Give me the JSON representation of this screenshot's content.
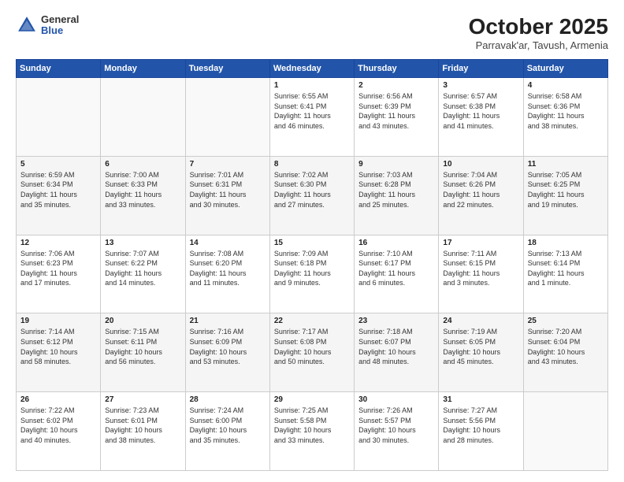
{
  "header": {
    "logo_general": "General",
    "logo_blue": "Blue",
    "title": "October 2025",
    "subtitle": "Parravak'ar, Tavush, Armenia"
  },
  "weekdays": [
    "Sunday",
    "Monday",
    "Tuesday",
    "Wednesday",
    "Thursday",
    "Friday",
    "Saturday"
  ],
  "rows": [
    [
      {
        "day": "",
        "info": ""
      },
      {
        "day": "",
        "info": ""
      },
      {
        "day": "",
        "info": ""
      },
      {
        "day": "1",
        "info": "Sunrise: 6:55 AM\nSunset: 6:41 PM\nDaylight: 11 hours\nand 46 minutes."
      },
      {
        "day": "2",
        "info": "Sunrise: 6:56 AM\nSunset: 6:39 PM\nDaylight: 11 hours\nand 43 minutes."
      },
      {
        "day": "3",
        "info": "Sunrise: 6:57 AM\nSunset: 6:38 PM\nDaylight: 11 hours\nand 41 minutes."
      },
      {
        "day": "4",
        "info": "Sunrise: 6:58 AM\nSunset: 6:36 PM\nDaylight: 11 hours\nand 38 minutes."
      }
    ],
    [
      {
        "day": "5",
        "info": "Sunrise: 6:59 AM\nSunset: 6:34 PM\nDaylight: 11 hours\nand 35 minutes."
      },
      {
        "day": "6",
        "info": "Sunrise: 7:00 AM\nSunset: 6:33 PM\nDaylight: 11 hours\nand 33 minutes."
      },
      {
        "day": "7",
        "info": "Sunrise: 7:01 AM\nSunset: 6:31 PM\nDaylight: 11 hours\nand 30 minutes."
      },
      {
        "day": "8",
        "info": "Sunrise: 7:02 AM\nSunset: 6:30 PM\nDaylight: 11 hours\nand 27 minutes."
      },
      {
        "day": "9",
        "info": "Sunrise: 7:03 AM\nSunset: 6:28 PM\nDaylight: 11 hours\nand 25 minutes."
      },
      {
        "day": "10",
        "info": "Sunrise: 7:04 AM\nSunset: 6:26 PM\nDaylight: 11 hours\nand 22 minutes."
      },
      {
        "day": "11",
        "info": "Sunrise: 7:05 AM\nSunset: 6:25 PM\nDaylight: 11 hours\nand 19 minutes."
      }
    ],
    [
      {
        "day": "12",
        "info": "Sunrise: 7:06 AM\nSunset: 6:23 PM\nDaylight: 11 hours\nand 17 minutes."
      },
      {
        "day": "13",
        "info": "Sunrise: 7:07 AM\nSunset: 6:22 PM\nDaylight: 11 hours\nand 14 minutes."
      },
      {
        "day": "14",
        "info": "Sunrise: 7:08 AM\nSunset: 6:20 PM\nDaylight: 11 hours\nand 11 minutes."
      },
      {
        "day": "15",
        "info": "Sunrise: 7:09 AM\nSunset: 6:18 PM\nDaylight: 11 hours\nand 9 minutes."
      },
      {
        "day": "16",
        "info": "Sunrise: 7:10 AM\nSunset: 6:17 PM\nDaylight: 11 hours\nand 6 minutes."
      },
      {
        "day": "17",
        "info": "Sunrise: 7:11 AM\nSunset: 6:15 PM\nDaylight: 11 hours\nand 3 minutes."
      },
      {
        "day": "18",
        "info": "Sunrise: 7:13 AM\nSunset: 6:14 PM\nDaylight: 11 hours\nand 1 minute."
      }
    ],
    [
      {
        "day": "19",
        "info": "Sunrise: 7:14 AM\nSunset: 6:12 PM\nDaylight: 10 hours\nand 58 minutes."
      },
      {
        "day": "20",
        "info": "Sunrise: 7:15 AM\nSunset: 6:11 PM\nDaylight: 10 hours\nand 56 minutes."
      },
      {
        "day": "21",
        "info": "Sunrise: 7:16 AM\nSunset: 6:09 PM\nDaylight: 10 hours\nand 53 minutes."
      },
      {
        "day": "22",
        "info": "Sunrise: 7:17 AM\nSunset: 6:08 PM\nDaylight: 10 hours\nand 50 minutes."
      },
      {
        "day": "23",
        "info": "Sunrise: 7:18 AM\nSunset: 6:07 PM\nDaylight: 10 hours\nand 48 minutes."
      },
      {
        "day": "24",
        "info": "Sunrise: 7:19 AM\nSunset: 6:05 PM\nDaylight: 10 hours\nand 45 minutes."
      },
      {
        "day": "25",
        "info": "Sunrise: 7:20 AM\nSunset: 6:04 PM\nDaylight: 10 hours\nand 43 minutes."
      }
    ],
    [
      {
        "day": "26",
        "info": "Sunrise: 7:22 AM\nSunset: 6:02 PM\nDaylight: 10 hours\nand 40 minutes."
      },
      {
        "day": "27",
        "info": "Sunrise: 7:23 AM\nSunset: 6:01 PM\nDaylight: 10 hours\nand 38 minutes."
      },
      {
        "day": "28",
        "info": "Sunrise: 7:24 AM\nSunset: 6:00 PM\nDaylight: 10 hours\nand 35 minutes."
      },
      {
        "day": "29",
        "info": "Sunrise: 7:25 AM\nSunset: 5:58 PM\nDaylight: 10 hours\nand 33 minutes."
      },
      {
        "day": "30",
        "info": "Sunrise: 7:26 AM\nSunset: 5:57 PM\nDaylight: 10 hours\nand 30 minutes."
      },
      {
        "day": "31",
        "info": "Sunrise: 7:27 AM\nSunset: 5:56 PM\nDaylight: 10 hours\nand 28 minutes."
      },
      {
        "day": "",
        "info": ""
      }
    ]
  ]
}
